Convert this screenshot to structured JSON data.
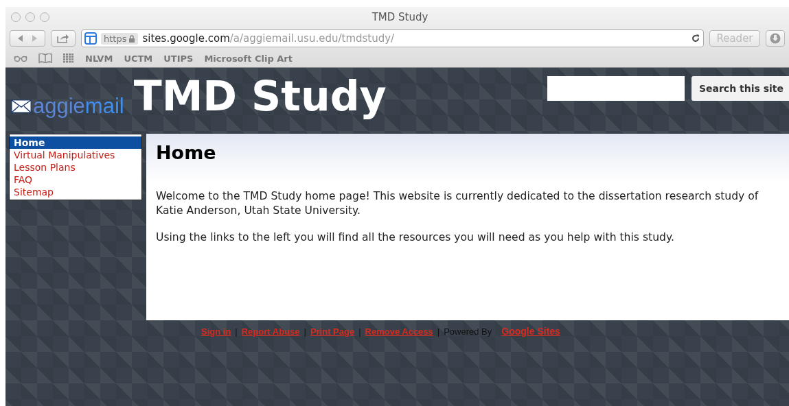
{
  "browser": {
    "title": "TMD Study",
    "address": {
      "scheme": "https",
      "host": "sites.google.com",
      "path": "/a/aggiemail.usu.edu/tmdstudy/"
    },
    "reader": "Reader",
    "bookmarks": [
      "NLVM",
      "UCTM",
      "UTIPS",
      "Microsoft Clip Art"
    ]
  },
  "site": {
    "logo": [
      "aggie",
      "mail"
    ],
    "title": "TMD Study",
    "search": {
      "button": "Search this site"
    },
    "nav": [
      {
        "label": "Home",
        "selected": true
      },
      {
        "label": "Virtual Manipulatives",
        "selected": false
      },
      {
        "label": "Lesson Plans",
        "selected": false
      },
      {
        "label": "FAQ",
        "selected": false
      },
      {
        "label": "Sitemap",
        "selected": false
      }
    ],
    "page": {
      "heading": "Home",
      "paragraphs": [
        "Welcome to the TMD Study home page! This website is currently dedicated to the dissertation research study of Katie Anderson, Utah State University.",
        "Using the links to the left you will find all the resources you will need as you help with this study."
      ]
    },
    "footer": [
      {
        "kind": "link",
        "text": "Sign in"
      },
      {
        "kind": "separator",
        "text": "|"
      },
      {
        "kind": "link",
        "text": "Report Abuse"
      },
      {
        "kind": "separator",
        "text": "|"
      },
      {
        "kind": "link",
        "text": "Print Page"
      },
      {
        "kind": "separator",
        "text": "|"
      },
      {
        "kind": "link",
        "text": "Remove Access"
      },
      {
        "kind": "separator",
        "text": "|"
      },
      {
        "kind": "text",
        "text": "Powered By"
      },
      {
        "kind": "brand",
        "text": "Google Sites"
      }
    ]
  }
}
